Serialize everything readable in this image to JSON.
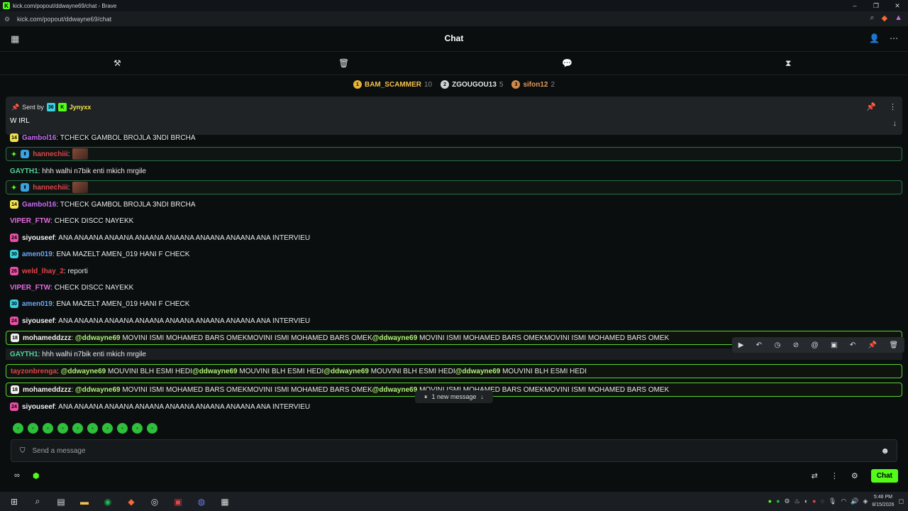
{
  "window": {
    "title": "kick.com/popout/ddwayne69/chat - Brave",
    "url": "kick.com/popout/ddwayne69/chat"
  },
  "header": {
    "title": "Chat"
  },
  "leaderboard": [
    {
      "rank": "1",
      "name": "BAM_SCAMMER",
      "count": "10",
      "color": "#e8b33a",
      "name_color": "#f2c14e"
    },
    {
      "rank": "2",
      "name": "ZGOUGOU13",
      "count": "5",
      "color": "#cfd3d6",
      "name_color": "#e6e6e6"
    },
    {
      "rank": "3",
      "name": "sifon12",
      "count": "2",
      "color": "#cf8b4a",
      "name_color": "#e29a5b"
    }
  ],
  "pinned": {
    "sent_by_label": "Sent by",
    "badge": "36",
    "user": "Jynyxx",
    "message": "W IRL"
  },
  "messages": [
    {
      "badge": "14",
      "badge_color": "#f2e44e",
      "user": "Gambol16",
      "user_color": "#c76cf2",
      "text": ": TCHECK GAMBOL BROJLA 3NDI BRCHA",
      "style": ""
    },
    {
      "badge": "",
      "badge_color": "",
      "user": "hannechiii",
      "user_color": "#e0454b",
      "text": ":",
      "style": "hl",
      "image": true
    },
    {
      "badge": "",
      "badge_color": "",
      "user": "GAYTH1",
      "user_color": "#53d39a",
      "text": ": hhh walhi n7bik enti mkich mrgile",
      "style": ""
    },
    {
      "badge": "",
      "badge_color": "",
      "user": "hannechiii",
      "user_color": "#e0454b",
      "text": ":",
      "style": "hl",
      "image": true
    },
    {
      "badge": "14",
      "badge_color": "#f2e44e",
      "user": "Gambol16",
      "user_color": "#c76cf2",
      "text": ": TCHECK GAMBOL BROJLA 3NDI BRCHA",
      "style": ""
    },
    {
      "badge": "",
      "badge_color": "",
      "user": "VIPER_FTW",
      "user_color": "#e26bdc",
      "text": ": CHECK DISCC NAYEKK",
      "style": ""
    },
    {
      "badge": "24",
      "badge_color": "#e94fa6",
      "user": "siyouseef",
      "user_color": "#f2f2f2",
      "text": ": ANA ANAANA ANAANA ANAANA ANAANA ANAANA ANAANA ANA INTERVIEU",
      "style": ""
    },
    {
      "badge": "30",
      "badge_color": "#38d1e0",
      "user": "amen019",
      "user_color": "#6aa8f7",
      "text": ": ENA MAZELT AMEN_019 HANI F CHECK",
      "style": ""
    },
    {
      "badge": "26",
      "badge_color": "#e94fa6",
      "user": "weld_lhay_2",
      "user_color": "#e0454b",
      "text": ": reporti",
      "style": ""
    },
    {
      "badge": "",
      "badge_color": "",
      "user": "VIPER_FTW",
      "user_color": "#e26bdc",
      "text": ": CHECK DISCC NAYEKK",
      "style": ""
    },
    {
      "badge": "30",
      "badge_color": "#38d1e0",
      "user": "amen019",
      "user_color": "#6aa8f7",
      "text": ": ENA MAZELT AMEN_019 HANI F CHECK",
      "style": ""
    },
    {
      "badge": "24",
      "badge_color": "#e94fa6",
      "user": "siyouseef",
      "user_color": "#f2f2f2",
      "text": ": ANA ANAANA ANAANA ANAANA ANAANA ANAANA ANAANA ANA INTERVIEU",
      "style": ""
    },
    {
      "badge": "18",
      "badge_color": "#f2f2f2",
      "user": "mohameddzzz",
      "user_color": "#f2f2f2",
      "text": ": @ddwayne69 MOVINI ISMI MOHAMED BARS OMEKMOVINI ISMI MOHAMED BARS OMEK@ddwayne69 MOVINI ISMI MOHAMED BARS OMEKMOVINI ISMI MOHAMED BARS OMEK",
      "style": "hl-green"
    },
    {
      "badge": "",
      "badge_color": "",
      "user": "GAYTH1",
      "user_color": "#53d39a",
      "text": ": hhh walhi n7bik enti mkich mrgile",
      "style": "hl-grey"
    },
    {
      "badge": "",
      "badge_color": "",
      "user": "tayzonbrenga",
      "user_color": "#e0454b",
      "text": ": @ddwayne69 MOUVINI BLH ESMI HEDI@ddwayne69 MOUVINI BLH ESMI HEDI@ddwayne69 MOUVINI BLH ESMI HEDI@ddwayne69 MOUVINI BLH ESMI HEDI",
      "style": "hl-green"
    },
    {
      "badge": "18",
      "badge_color": "#f2f2f2",
      "user": "mohameddzzz",
      "user_color": "#f2f2f2",
      "text": ": @ddwayne69 MOVINI ISMI MOHAMED BARS OMEKMOVINI ISMI MOHAMED BARS OMEK@ddwayne69 MOVINI ISMI MOHAMED BARS OMEKMOVINI ISMI MOHAMED BARS OMEK",
      "style": "hl-green"
    },
    {
      "badge": "24",
      "badge_color": "#e94fa6",
      "user": "siyouseef",
      "user_color": "#f2f2f2",
      "text": ": ANA ANAANA ANAANA ANAANA ANAANA ANAANA ANAANA ANA INTERVIEU",
      "style": ""
    }
  ],
  "new_message": "1 new message",
  "input": {
    "placeholder": "Send a message"
  },
  "bottom": {
    "chat_button": "Chat"
  },
  "taskbar": {
    "time": "5:46 PM",
    "date": "8/15/2026"
  },
  "colors": {
    "accent": "#53fc18",
    "background": "#0b0e0f"
  }
}
